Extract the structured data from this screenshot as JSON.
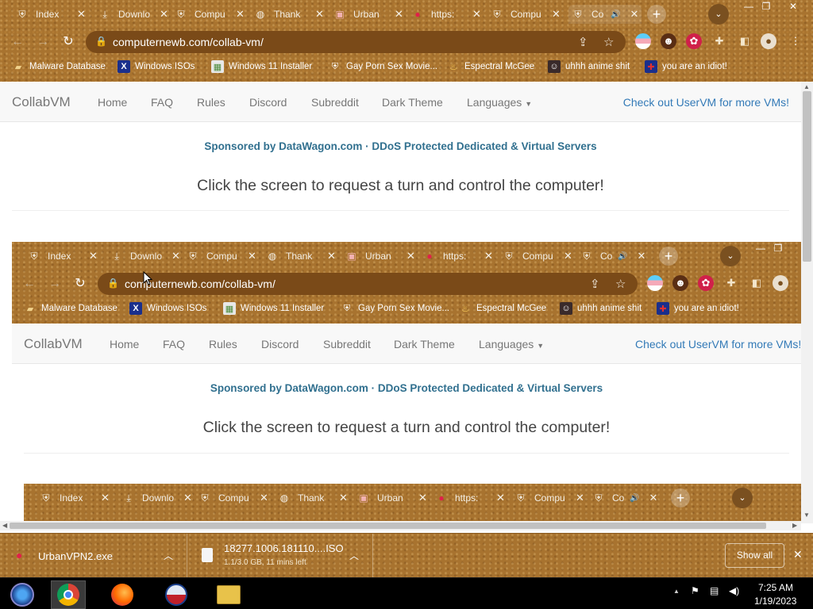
{
  "browser": {
    "tabs": [
      {
        "title": "Index",
        "icon": "crest-icon"
      },
      {
        "title": "Downlo",
        "icon": "download-icon"
      },
      {
        "title": "Compu",
        "icon": "crest-icon"
      },
      {
        "title": "Thank",
        "icon": "globe-icon"
      },
      {
        "title": "Urban",
        "icon": "urban-icon"
      },
      {
        "title": "https:",
        "icon": "red-blob-icon"
      },
      {
        "title": "Compu",
        "icon": "crest-icon"
      },
      {
        "title": "Co",
        "icon": "crest-icon",
        "audio": true
      }
    ],
    "new_tab": "+",
    "url": "computernewb.com/collab-vm/",
    "bookmarks": [
      {
        "label": "Malware Database",
        "icon": "folder-icon"
      },
      {
        "label": "Windows ISOs",
        "icon": "x-icon"
      },
      {
        "label": "Windows 11 Installer",
        "icon": "image-icon"
      },
      {
        "label": "Gay Porn Sex Movie...",
        "icon": "crest-icon"
      },
      {
        "label": "Espectral McGee",
        "icon": "flame-icon"
      },
      {
        "label": "uhhh anime shit",
        "icon": "anime-icon"
      },
      {
        "label": "you are an idiot!",
        "icon": "flag-icon"
      }
    ]
  },
  "site": {
    "brand": "CollabVM",
    "nav": [
      "Home",
      "FAQ",
      "Rules",
      "Discord",
      "Subreddit",
      "Dark Theme",
      "Languages"
    ],
    "nav_right": "Check out UserVM for more VMs!",
    "sponsor": "Sponsored by DataWagon.com · DDoS Protected Dedicated & Virtual Servers",
    "click_message": "Click the screen to request a turn and control the computer!"
  },
  "downloads": [
    {
      "name": "UrbanVPN2.exe",
      "status": ""
    },
    {
      "name": "18277.1006.181110....ISO",
      "status": "1.1/3.0 GB, 11 mins left"
    }
  ],
  "show_all": "Show all",
  "taskbar": {
    "time": "7:25 AM",
    "date": "1/19/2023"
  },
  "colors": {
    "chrome_brown": "#a8732f",
    "link_blue": "#337ab7",
    "sponsor_blue": "#31708f"
  }
}
